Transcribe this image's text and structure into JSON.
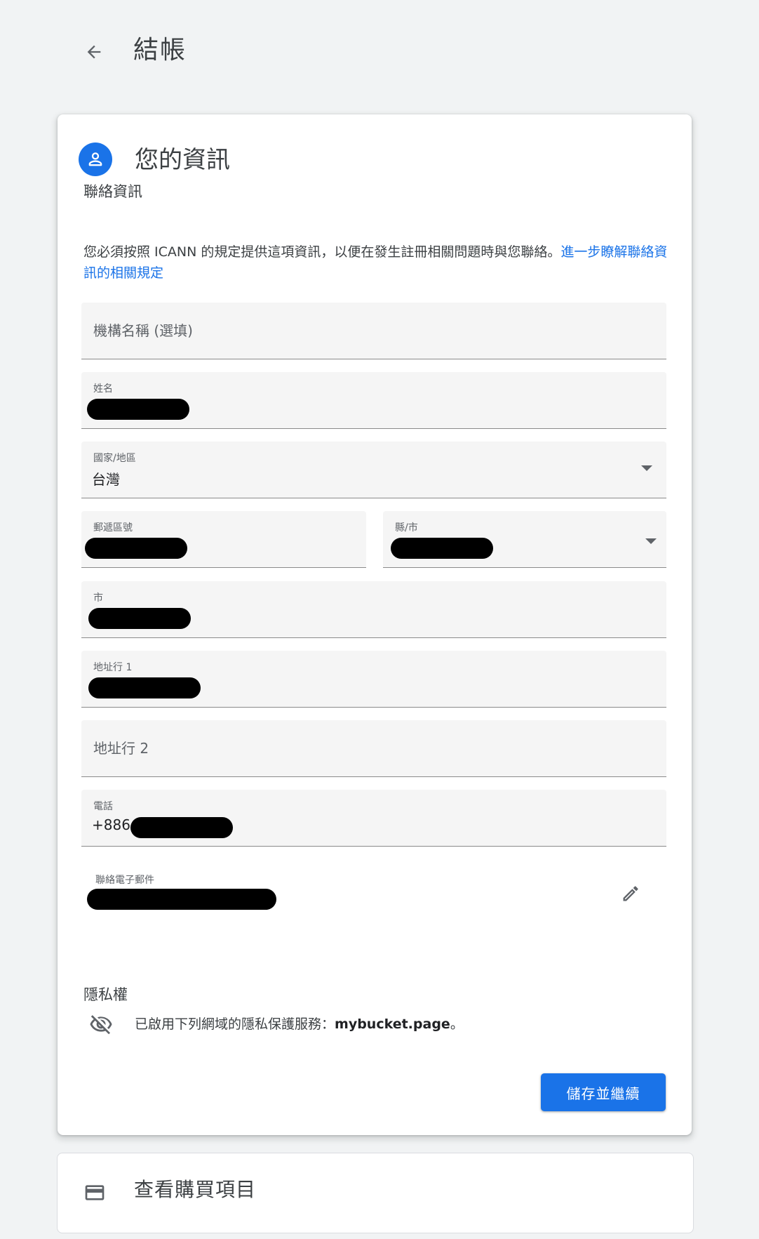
{
  "header": {
    "back_icon": "arrow-back-icon",
    "title": "結帳"
  },
  "info_card": {
    "avatar_icon": "person-icon",
    "title": "您的資訊",
    "contact_section_title": "聯絡資訊",
    "notice_text": "您必須按照 ICANN 的規定提供這項資訊，以便在發生註冊相關問題時與您聯絡。",
    "notice_link": "進一步瞭解聯絡資訊的相關規定",
    "fields": {
      "organization": {
        "placeholder": "機構名稱 (選填)"
      },
      "name": {
        "label": "姓名"
      },
      "country": {
        "label": "國家/地區",
        "value": "台灣"
      },
      "postal_code": {
        "label": "郵遞區號"
      },
      "county": {
        "label": "縣/市"
      },
      "city": {
        "label": "市"
      },
      "address1": {
        "label": "地址行 1"
      },
      "address2": {
        "placeholder": "地址行 2"
      },
      "phone": {
        "label": "電話",
        "prefix": "+886"
      },
      "email": {
        "label": "聯絡電子郵件"
      }
    },
    "edit_icon": "pencil-edit-icon",
    "privacy_section_title": "隱私權",
    "privacy_icon": "visibility-off-icon",
    "privacy_text": "已啟用下列網域的隱私保護服務：",
    "privacy_domain": "mybucket.page",
    "privacy_suffix": "。",
    "save_button": "儲存並繼續"
  },
  "purchase_card": {
    "icon": "credit-card-icon",
    "title": "查看購買項目"
  },
  "colors": {
    "accent": "#1a73e8",
    "background": "#f1f3f4",
    "field_bg": "#f5f5f5"
  }
}
